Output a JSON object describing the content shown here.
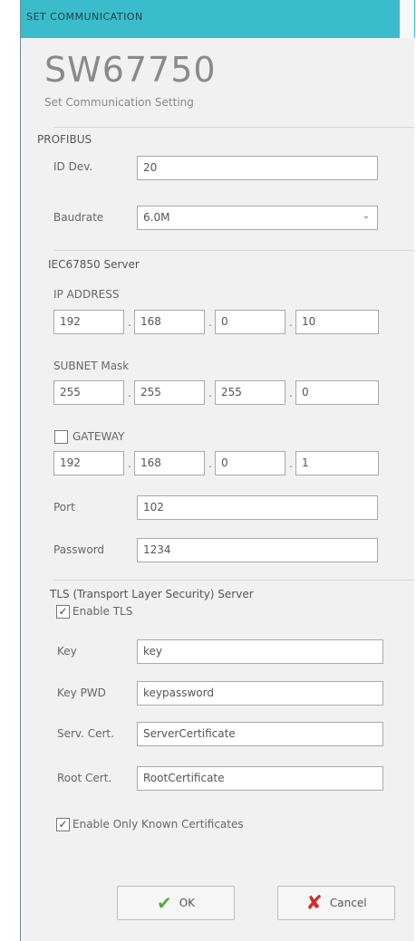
{
  "window": {
    "title": "SET COMMUNICATION"
  },
  "brand": {
    "model": "SW67750",
    "subtitle": "Set Communication Setting"
  },
  "profibus": {
    "title": "PROFIBUS",
    "id_label": "ID Dev.",
    "id_value": "20",
    "baud_label": "Baudrate",
    "baud_value": "6.0M"
  },
  "server": {
    "title": "IEC67850 Server",
    "ip_label": "IP ADDRESS",
    "ip": [
      "192",
      "168",
      "0",
      "10"
    ],
    "subnet_label": "SUBNET Mask",
    "subnet": [
      "255",
      "255",
      "255",
      "0"
    ],
    "gateway_label": "GATEWAY",
    "gateway_checked": false,
    "gateway": [
      "192",
      "168",
      "0",
      "1"
    ],
    "port_label": "Port",
    "port_value": "102",
    "password_label": "Password",
    "password_value": "1234",
    "dot": "."
  },
  "tls": {
    "title": "TLS (Transport Layer Security) Server",
    "enable_label": "Enable TLS",
    "enable_checked": true,
    "key_label": "Key",
    "key_value": "key",
    "keypwd_label": "Key PWD",
    "keypwd_value": "keypassword",
    "servcert_label": "Serv. Cert.",
    "servcert_value": "ServerCertificate",
    "rootcert_label": "Root Cert.",
    "rootcert_value": "RootCertificate",
    "known_label": "Enable Only Known Certificates",
    "known_checked": true
  },
  "buttons": {
    "ok_label": "OK",
    "cancel_label": "Cancel"
  },
  "icons": {
    "ok": "checkmark-icon",
    "cancel": "cross-icon",
    "dropdown": "chevron-down-icon"
  },
  "colors": {
    "titlebar": "#3bbccb",
    "ok": "#5aa843",
    "cancel": "#d0322b"
  },
  "check_glyph": "✓"
}
